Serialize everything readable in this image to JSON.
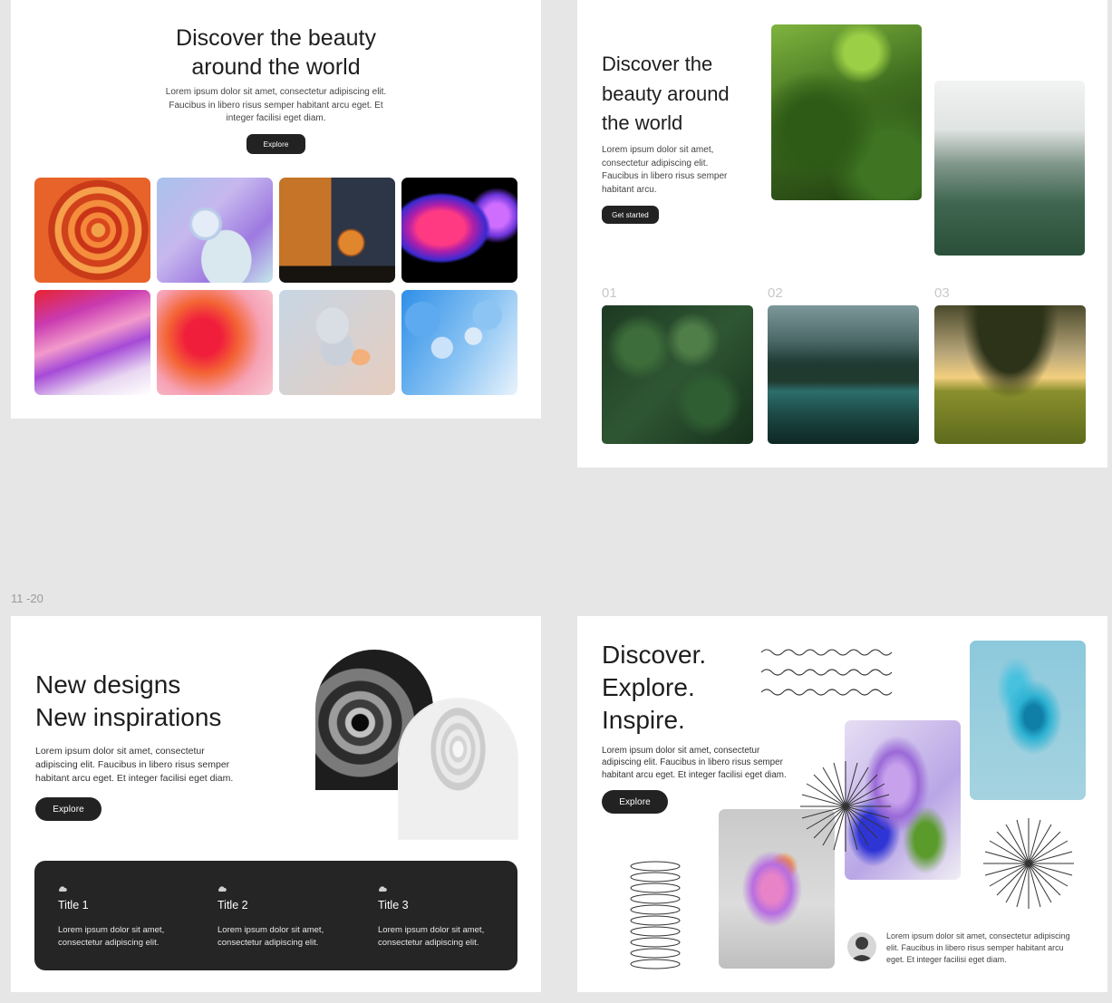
{
  "section_label": "11 -20",
  "slide1": {
    "title": "Discover the beauty around the world",
    "body": "Lorem ipsum dolor sit amet, consectetur adipiscing elit. Faucibus in libero risus semper habitant arcu eget. Et integer facilisi eget diam.",
    "button": "Explore",
    "tiles": [
      "orange-swirl-image",
      "pastel-sphere-image",
      "wire-basket-image",
      "neon-blob-image",
      "pink-gradient-image",
      "red-gradient-image",
      "stacked-discs-image",
      "blue-bubbles-image"
    ]
  },
  "slide2": {
    "title": "Discover the beauty around the world",
    "body": "Lorem ipsum dolor sit amet, consectetur adipiscing elit. Faucibus in libero risus semper habitant arcu.",
    "button": "Get started",
    "numbers": [
      "01",
      "02",
      "03"
    ]
  },
  "slide3": {
    "title_line1": "New designs",
    "title_line2": "New inspirations",
    "body": "Lorem ipsum dolor sit amet, consectetur adipiscing elit. Faucibus in libero risus semper habitant arcu eget. Et integer facilisi eget diam.",
    "button": "Explore",
    "cards": [
      {
        "title": "Title 1",
        "text": "Lorem ipsum dolor sit amet, consectetur adipiscing elit."
      },
      {
        "title": "Title 2",
        "text": "Lorem ipsum dolor sit amet, consectetur adipiscing elit."
      },
      {
        "title": "Title 3",
        "text": "Lorem ipsum dolor sit amet, consectetur adipiscing elit."
      }
    ]
  },
  "slide4": {
    "title_line1": "Discover.",
    "title_line2": "Explore.",
    "title_line3": "Inspire.",
    "body": "Lorem ipsum dolor sit amet, consectetur adipiscing elit. Faucibus in libero risus semper habitant arcu eget. Et integer facilisi eget diam.",
    "button": "Explore",
    "quote": "Lorem ipsum dolor sit amet, consectetur adipiscing elit. Faucibus in libero risus semper habitant arcu eget. Et integer facilisi eget diam."
  }
}
